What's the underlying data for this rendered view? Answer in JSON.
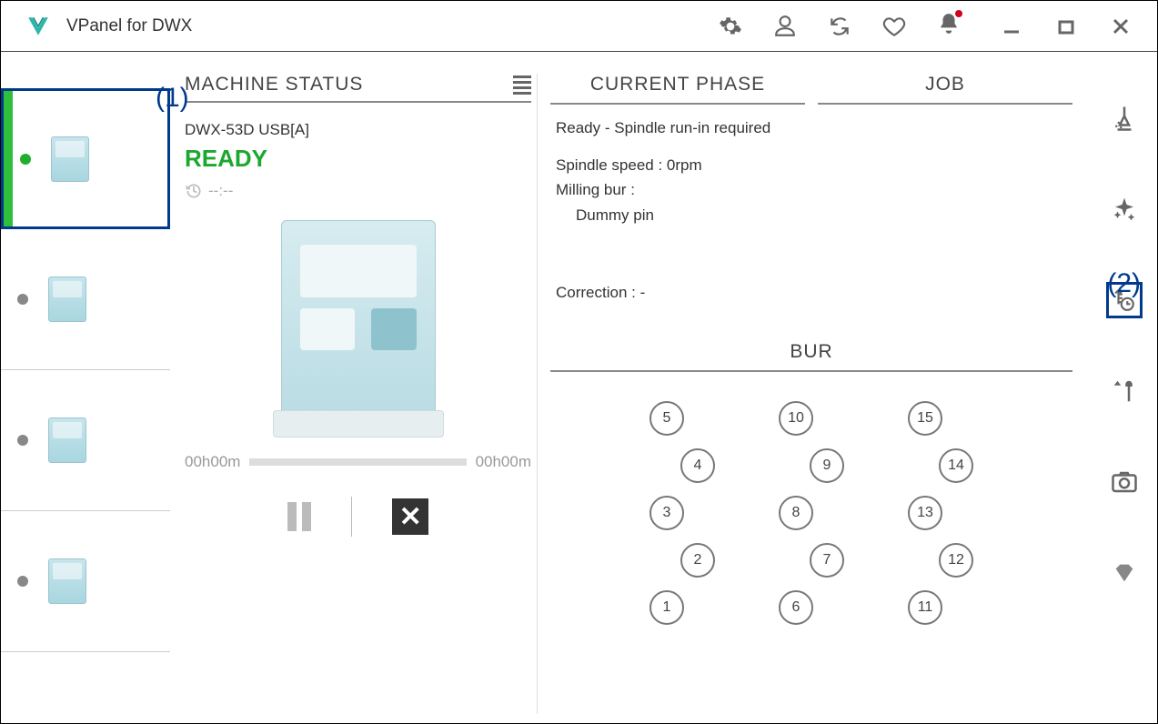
{
  "app": {
    "title": "VPanel for DWX"
  },
  "annotations": {
    "a1": "(1)",
    "a2": "(2)"
  },
  "status": {
    "header": "MACHINE STATUS",
    "machine_name": "DWX-53D USB[A]",
    "state": "READY",
    "time_placeholder": "--:--",
    "progress_start": "00h00m",
    "progress_end": "00h00m"
  },
  "phase": {
    "header": "CURRENT PHASE",
    "line1": "Ready - Spindle run-in required",
    "line2": "Spindle speed : 0rpm",
    "line3": "Milling bur :",
    "line3b": "Dummy pin",
    "line4": "Correction : -"
  },
  "job": {
    "header": "JOB"
  },
  "bur": {
    "header": "BUR",
    "cols": [
      [
        "5",
        "4",
        "3",
        "2",
        "1"
      ],
      [
        "10",
        "9",
        "8",
        "7",
        "6"
      ],
      [
        "15",
        "14",
        "13",
        "12",
        "11"
      ]
    ]
  }
}
